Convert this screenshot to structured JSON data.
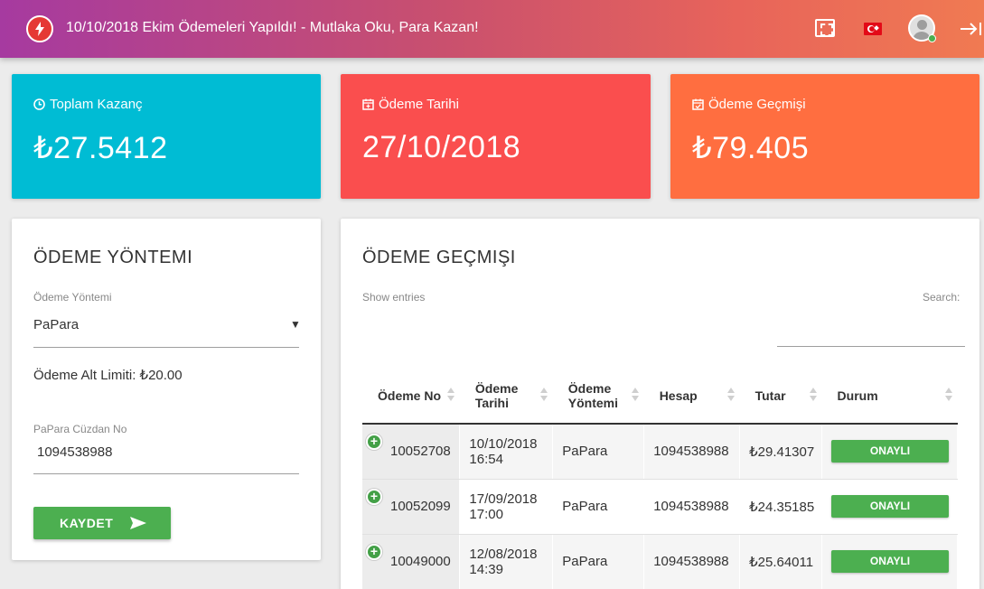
{
  "topbar": {
    "title": "10/10/2018 Ekim Ödemeleri Yapıldı! - Mutlaka Oku, Para Kazan!",
    "icons": [
      "lightning-icon",
      "fullscreen-icon",
      "turkey-flag-icon",
      "avatar",
      "logout-icon"
    ]
  },
  "stats": [
    {
      "label": "Toplam Kazanç",
      "value": "₺27.5412",
      "icon": "clock-icon",
      "color": "#00bcd4"
    },
    {
      "label": "Ödeme Tarihi",
      "value": "27/10/2018",
      "icon": "calendar-plus-icon",
      "color": "#fa4e4e"
    },
    {
      "label": "Ödeme Geçmişi",
      "value": "₺79.405",
      "icon": "calendar-check-icon",
      "color": "#ff6e40"
    }
  ],
  "payment_method": {
    "title": "ÖDEME YÖNTEMI",
    "method_label": "Ödeme Yöntemi",
    "method_value": "PaPara",
    "min_limit": "Ödeme Alt Limiti: ₺20.00",
    "wallet_label": "PaPara Cüzdan No",
    "wallet_value": "1094538988",
    "save_label": "KAYDET"
  },
  "history": {
    "title": "ÖDEME GEÇMIŞI",
    "show_entries": "Show entries",
    "search_label": "Search:",
    "columns": [
      "Ödeme No",
      "Ödeme Tarihi",
      "Ödeme Yöntemi",
      "Hesap",
      "Tutar",
      "Durum"
    ],
    "rows": [
      {
        "no": "10052708",
        "date": "10/10/2018",
        "time": "16:54",
        "method": "PaPara",
        "account": "1094538988",
        "amount": "₺29.41307",
        "status": "ONAYLI"
      },
      {
        "no": "10052099",
        "date": "17/09/2018",
        "time": "17:00",
        "method": "PaPara",
        "account": "1094538988",
        "amount": "₺24.35185",
        "status": "ONAYLI"
      },
      {
        "no": "10049000",
        "date": "12/08/2018",
        "time": "14:39",
        "method": "PaPara",
        "account": "1094538988",
        "amount": "₺25.64011",
        "status": "ONAYLI"
      }
    ]
  }
}
